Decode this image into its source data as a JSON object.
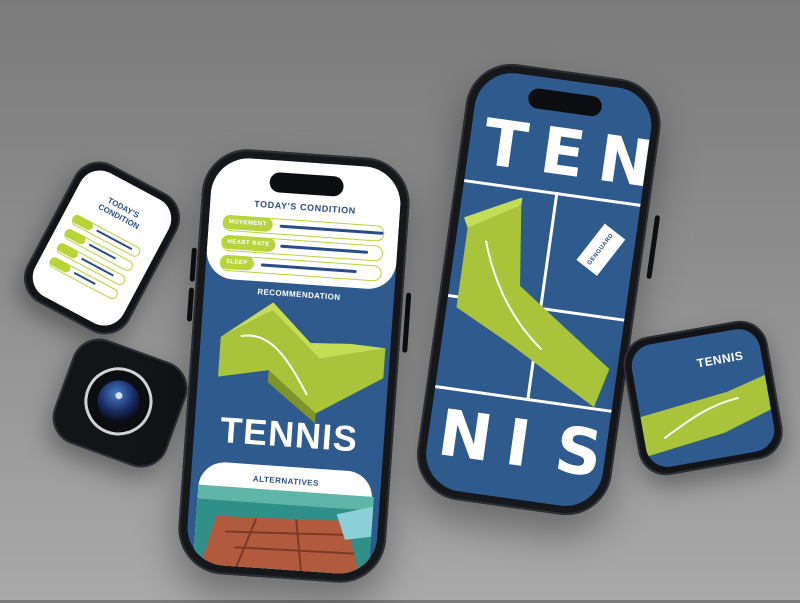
{
  "colors": {
    "background": "#8e8e8e",
    "screen_blue": "#2f5a8d",
    "accent_lime": "#b8d43a",
    "text_navy": "#2b4d85",
    "white": "#ffffff",
    "device_black": "#15171b"
  },
  "phone_main": {
    "condition_title": "TODAY'S CONDITION",
    "metrics": [
      {
        "label": "MOVEMENT"
      },
      {
        "label": "HEART RATE"
      },
      {
        "label": "SLEEP"
      }
    ],
    "recommendation_label": "RECOMMENDATION",
    "sport_title": "TENNIS",
    "alternatives_title": "ALTERNATIVES"
  },
  "phone_poster": {
    "letters_top": [
      "T",
      "E",
      "N"
    ],
    "letters_bottom": [
      "N",
      "I",
      "S"
    ],
    "brand_tag": "GENGUARD"
  },
  "watch_condition": {
    "title_line1": "TODAY'S",
    "title_line2": "CONDITION"
  },
  "watch_tennis": {
    "title": "TENNIS"
  },
  "icons": {
    "camera_lens": "camera-lens-icon"
  }
}
